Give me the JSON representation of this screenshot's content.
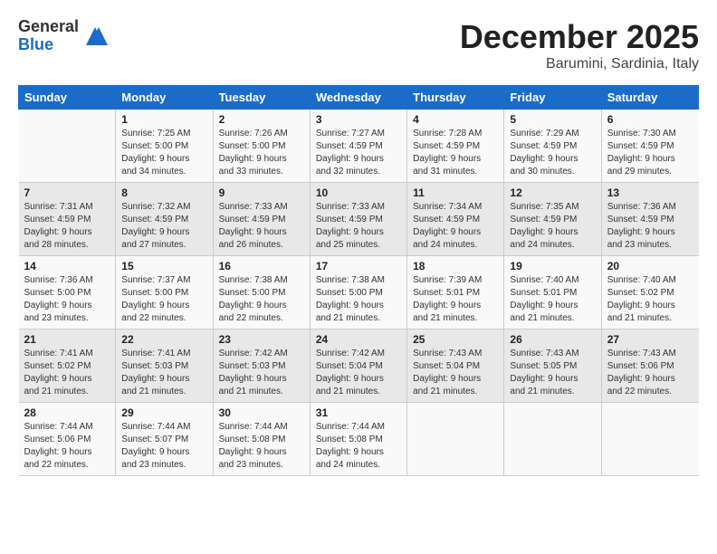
{
  "logo": {
    "general": "General",
    "blue": "Blue"
  },
  "title": "December 2025",
  "location": "Barumini, Sardinia, Italy",
  "weekdays": [
    "Sunday",
    "Monday",
    "Tuesday",
    "Wednesday",
    "Thursday",
    "Friday",
    "Saturday"
  ],
  "weeks": [
    [
      {
        "day": "",
        "info": ""
      },
      {
        "day": "1",
        "info": "Sunrise: 7:25 AM\nSunset: 5:00 PM\nDaylight: 9 hours\nand 34 minutes."
      },
      {
        "day": "2",
        "info": "Sunrise: 7:26 AM\nSunset: 5:00 PM\nDaylight: 9 hours\nand 33 minutes."
      },
      {
        "day": "3",
        "info": "Sunrise: 7:27 AM\nSunset: 4:59 PM\nDaylight: 9 hours\nand 32 minutes."
      },
      {
        "day": "4",
        "info": "Sunrise: 7:28 AM\nSunset: 4:59 PM\nDaylight: 9 hours\nand 31 minutes."
      },
      {
        "day": "5",
        "info": "Sunrise: 7:29 AM\nSunset: 4:59 PM\nDaylight: 9 hours\nand 30 minutes."
      },
      {
        "day": "6",
        "info": "Sunrise: 7:30 AM\nSunset: 4:59 PM\nDaylight: 9 hours\nand 29 minutes."
      }
    ],
    [
      {
        "day": "7",
        "info": "Sunrise: 7:31 AM\nSunset: 4:59 PM\nDaylight: 9 hours\nand 28 minutes."
      },
      {
        "day": "8",
        "info": "Sunrise: 7:32 AM\nSunset: 4:59 PM\nDaylight: 9 hours\nand 27 minutes."
      },
      {
        "day": "9",
        "info": "Sunrise: 7:33 AM\nSunset: 4:59 PM\nDaylight: 9 hours\nand 26 minutes."
      },
      {
        "day": "10",
        "info": "Sunrise: 7:33 AM\nSunset: 4:59 PM\nDaylight: 9 hours\nand 25 minutes."
      },
      {
        "day": "11",
        "info": "Sunrise: 7:34 AM\nSunset: 4:59 PM\nDaylight: 9 hours\nand 24 minutes."
      },
      {
        "day": "12",
        "info": "Sunrise: 7:35 AM\nSunset: 4:59 PM\nDaylight: 9 hours\nand 24 minutes."
      },
      {
        "day": "13",
        "info": "Sunrise: 7:36 AM\nSunset: 4:59 PM\nDaylight: 9 hours\nand 23 minutes."
      }
    ],
    [
      {
        "day": "14",
        "info": "Sunrise: 7:36 AM\nSunset: 5:00 PM\nDaylight: 9 hours\nand 23 minutes."
      },
      {
        "day": "15",
        "info": "Sunrise: 7:37 AM\nSunset: 5:00 PM\nDaylight: 9 hours\nand 22 minutes."
      },
      {
        "day": "16",
        "info": "Sunrise: 7:38 AM\nSunset: 5:00 PM\nDaylight: 9 hours\nand 22 minutes."
      },
      {
        "day": "17",
        "info": "Sunrise: 7:38 AM\nSunset: 5:00 PM\nDaylight: 9 hours\nand 21 minutes."
      },
      {
        "day": "18",
        "info": "Sunrise: 7:39 AM\nSunset: 5:01 PM\nDaylight: 9 hours\nand 21 minutes."
      },
      {
        "day": "19",
        "info": "Sunrise: 7:40 AM\nSunset: 5:01 PM\nDaylight: 9 hours\nand 21 minutes."
      },
      {
        "day": "20",
        "info": "Sunrise: 7:40 AM\nSunset: 5:02 PM\nDaylight: 9 hours\nand 21 minutes."
      }
    ],
    [
      {
        "day": "21",
        "info": "Sunrise: 7:41 AM\nSunset: 5:02 PM\nDaylight: 9 hours\nand 21 minutes."
      },
      {
        "day": "22",
        "info": "Sunrise: 7:41 AM\nSunset: 5:03 PM\nDaylight: 9 hours\nand 21 minutes."
      },
      {
        "day": "23",
        "info": "Sunrise: 7:42 AM\nSunset: 5:03 PM\nDaylight: 9 hours\nand 21 minutes."
      },
      {
        "day": "24",
        "info": "Sunrise: 7:42 AM\nSunset: 5:04 PM\nDaylight: 9 hours\nand 21 minutes."
      },
      {
        "day": "25",
        "info": "Sunrise: 7:43 AM\nSunset: 5:04 PM\nDaylight: 9 hours\nand 21 minutes."
      },
      {
        "day": "26",
        "info": "Sunrise: 7:43 AM\nSunset: 5:05 PM\nDaylight: 9 hours\nand 21 minutes."
      },
      {
        "day": "27",
        "info": "Sunrise: 7:43 AM\nSunset: 5:06 PM\nDaylight: 9 hours\nand 22 minutes."
      }
    ],
    [
      {
        "day": "28",
        "info": "Sunrise: 7:44 AM\nSunset: 5:06 PM\nDaylight: 9 hours\nand 22 minutes."
      },
      {
        "day": "29",
        "info": "Sunrise: 7:44 AM\nSunset: 5:07 PM\nDaylight: 9 hours\nand 23 minutes."
      },
      {
        "day": "30",
        "info": "Sunrise: 7:44 AM\nSunset: 5:08 PM\nDaylight: 9 hours\nand 23 minutes."
      },
      {
        "day": "31",
        "info": "Sunrise: 7:44 AM\nSunset: 5:08 PM\nDaylight: 9 hours\nand 24 minutes."
      },
      {
        "day": "",
        "info": ""
      },
      {
        "day": "",
        "info": ""
      },
      {
        "day": "",
        "info": ""
      }
    ]
  ]
}
